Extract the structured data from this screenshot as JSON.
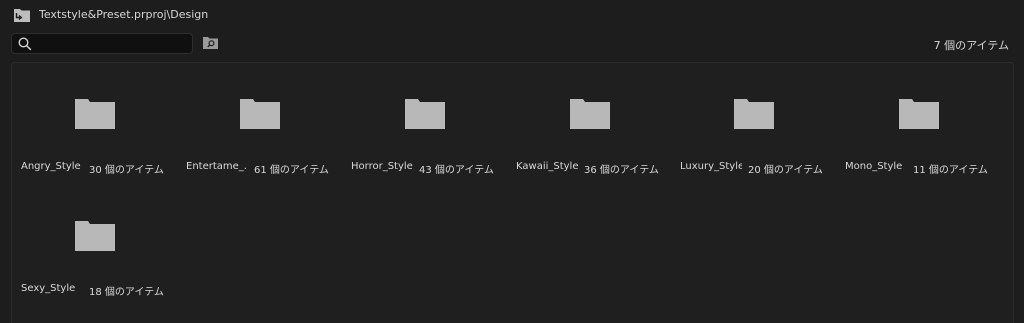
{
  "header": {
    "title": "Textstyle&Preset.prproj\\Design",
    "bin_icon": "bin-folder-icon"
  },
  "search": {
    "value": "",
    "placeholder": "",
    "icon": "search-icon"
  },
  "toolbar": {
    "find_icon": "find-bin-icon"
  },
  "status": {
    "item_count": "7 個のアイテム"
  },
  "colors": {
    "background": "#1d1d1d",
    "panel": "#1f1f1f",
    "folder": "#b8b8b8",
    "text": "#d8d8d8"
  },
  "items": [
    {
      "name": "Angry_Style",
      "count": "30 個のアイテム",
      "icon": "folder-icon"
    },
    {
      "name": "Entertame_...",
      "count": "61 個のアイテム",
      "icon": "folder-icon"
    },
    {
      "name": "Horror_Style",
      "count": "43 個のアイテム",
      "icon": "folder-icon"
    },
    {
      "name": "Kawaii_Style",
      "count": "36 個のアイテム",
      "icon": "folder-icon"
    },
    {
      "name": "Luxury_Style",
      "count": "20 個のアイテム",
      "icon": "folder-icon"
    },
    {
      "name": "Mono_Style",
      "count": "11 個のアイテム",
      "icon": "folder-icon"
    },
    {
      "name": "Sexy_Style",
      "count": "18 個のアイテム",
      "icon": "folder-icon"
    }
  ]
}
